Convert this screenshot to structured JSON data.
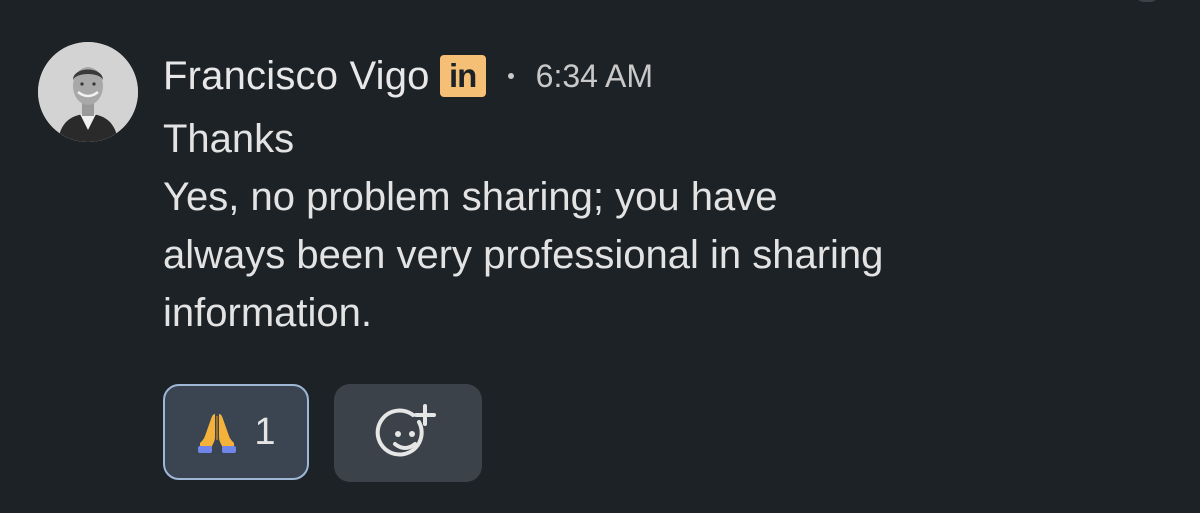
{
  "message": {
    "sender_name": "Francisco Vigo",
    "badge_text": "in",
    "timestamp": "6:34 AM",
    "body_lines": [
      "Thanks",
      "Yes, no problem sharing; you have",
      "always been very professional in sharing",
      "information."
    ]
  },
  "reactions": [
    {
      "emoji": "folded-hands-icon",
      "count": "1"
    }
  ],
  "add_reaction_icon": "add-reaction-icon",
  "colors": {
    "background": "#1d2226",
    "badge": "#f5c075",
    "chip_border": "#9fb7d6",
    "chip_fill": "#3a4551"
  }
}
